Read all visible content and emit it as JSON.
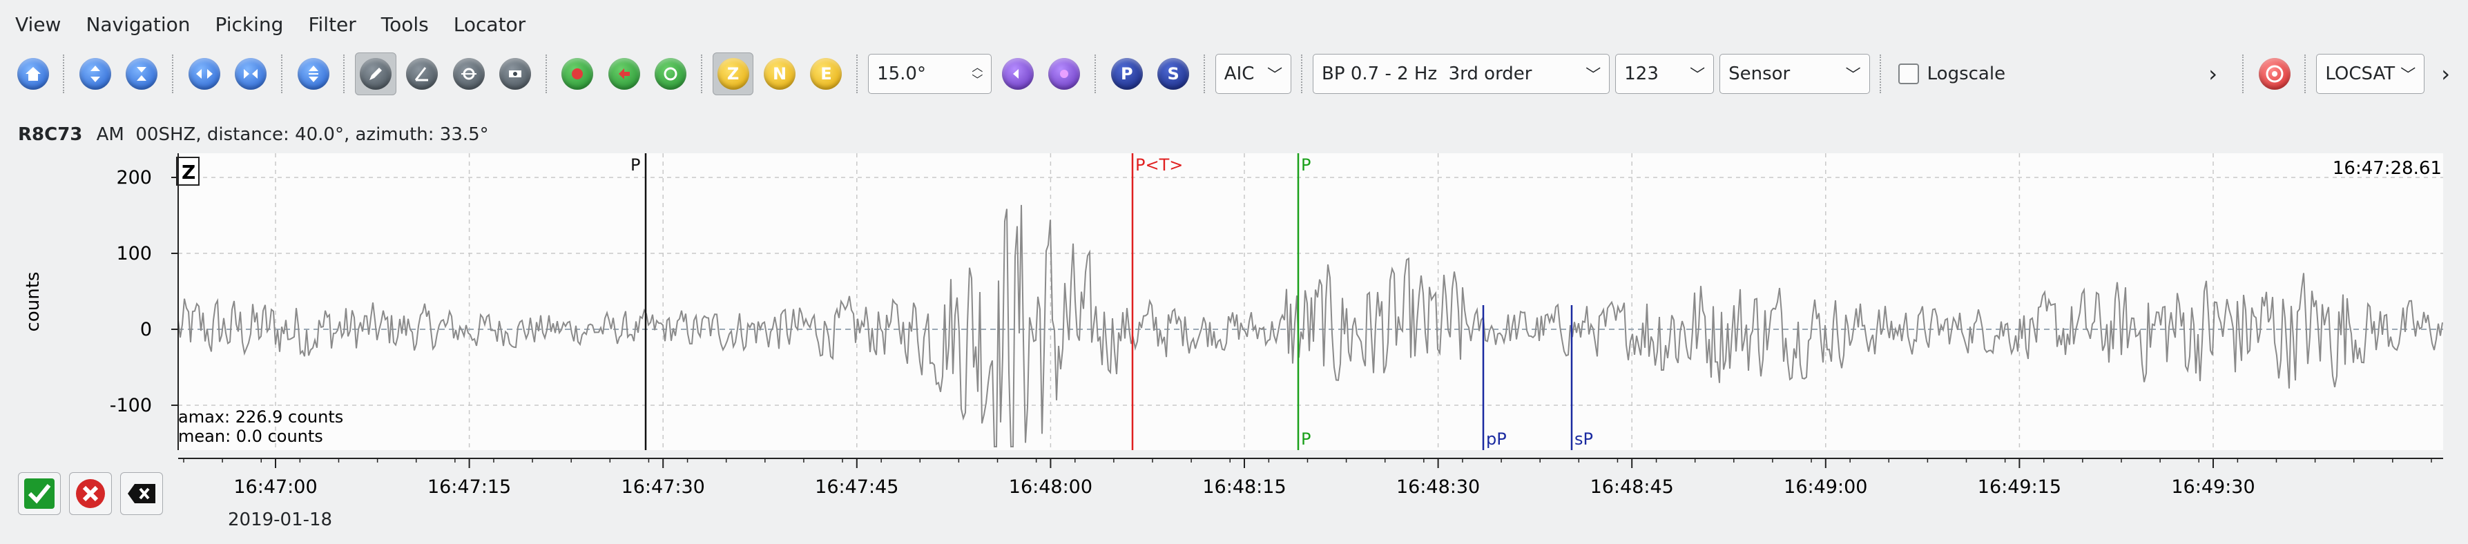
{
  "menu": [
    "View",
    "Navigation",
    "Picking",
    "Filter",
    "Tools",
    "Locator"
  ],
  "toolbar": {
    "angle_value": "15.0°",
    "picker_method": "AIC",
    "filter": "BP 0.7 - 2 Hz  3rd order",
    "components": "123",
    "unit": "Sensor",
    "logscale_label": "Logscale",
    "locator": "LOCSAT",
    "zne": [
      "Z",
      "N",
      "E"
    ],
    "phase_buttons": [
      "P",
      "S"
    ],
    "more_glyph": "›"
  },
  "trace": {
    "station": "R8C73",
    "header_rest": "AM  00SHZ, distance: 40.0°, azimuth: 33.5°",
    "component_box": "Z",
    "ylabel": "counts",
    "yticks": [
      "200",
      "100",
      "0",
      "-100"
    ],
    "time_readout": "16:47:28.61",
    "amax": "amax: 226.9 counts",
    "mean": "mean: 0.0 counts",
    "xticks": [
      "16:47:00",
      "16:47:15",
      "16:47:30",
      "16:47:45",
      "16:48:00",
      "16:48:15",
      "16:48:30",
      "16:48:45",
      "16:49:00",
      "16:49:15",
      "16:49:30"
    ],
    "date": "2019-01-18",
    "picks": [
      {
        "label": "P",
        "color": "#111111",
        "position": "top"
      },
      {
        "label": "P<T>",
        "color": "#e02020",
        "position": "top"
      },
      {
        "label": "P",
        "color": "#1aa01a",
        "position": "both"
      },
      {
        "label": "pP",
        "color": "#1a2aa0",
        "position": "bottom"
      },
      {
        "label": "sP",
        "color": "#1a2aa0",
        "position": "bottom"
      }
    ],
    "waveform_color": "#8a8a8a"
  }
}
